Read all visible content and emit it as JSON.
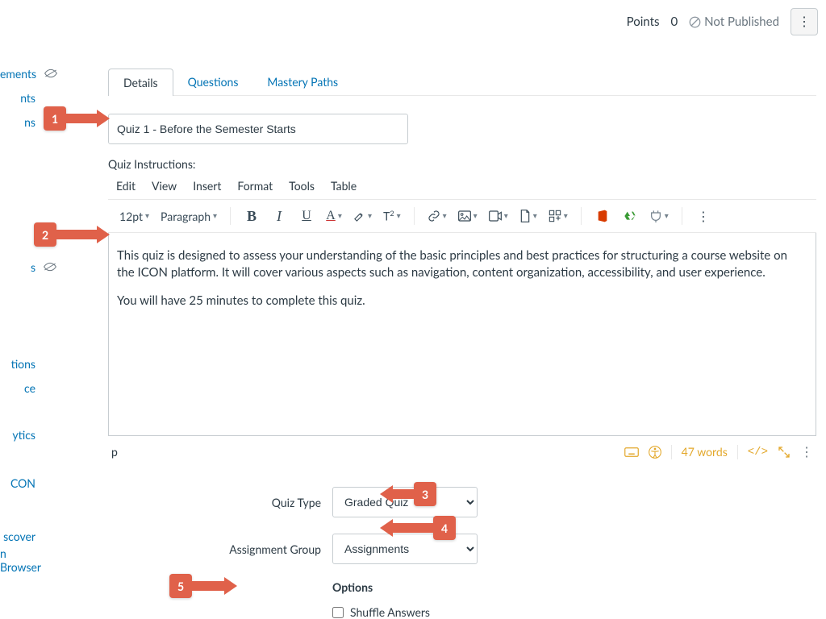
{
  "sidebar": {
    "items": [
      {
        "label": "ements",
        "hidden": true
      },
      {
        "label": "nts",
        "hidden": false
      },
      {
        "label": "ns",
        "hidden": false
      }
    ],
    "items2": [
      {
        "label": "s",
        "hidden": true
      }
    ],
    "items3": [
      {
        "label": "tions"
      },
      {
        "label": "ce"
      }
    ],
    "items4": [
      {
        "label": "ytics"
      }
    ],
    "items5": [
      {
        "label": "CON"
      }
    ],
    "items6": [
      {
        "label": "scover"
      },
      {
        "label": "n Browser"
      }
    ]
  },
  "header": {
    "points_label": "Points",
    "points_value": "0",
    "not_published": "Not Published"
  },
  "tabs": {
    "details": "Details",
    "questions": "Questions",
    "mastery": "Mastery Paths"
  },
  "title_value": "Quiz 1 - Before the Semester Starts",
  "instructions_label": "Quiz Instructions:",
  "rce_menu": {
    "edit": "Edit",
    "view": "View",
    "insert": "Insert",
    "format": "Format",
    "tools": "Tools",
    "table": "Table"
  },
  "toolbar": {
    "font_size": "12pt",
    "paragraph": "Paragraph"
  },
  "editor": {
    "p1": "This quiz is designed to assess your understanding of the basic principles and best practices for structuring a course website on the ICON platform. It will cover various aspects such as navigation, content organization, accessibility, and user experience.",
    "p2": "You will have 25 minutes to complete this quiz."
  },
  "footer": {
    "path": "p",
    "word_count": "47 words"
  },
  "settings": {
    "quiz_type_label": "Quiz Type",
    "quiz_type_value": "Graded Quiz",
    "assignment_group_label": "Assignment Group",
    "assignment_group_value": "Assignments",
    "options_label": "Options",
    "shuffle_label": "Shuffle Answers"
  },
  "callouts": {
    "c1": "1",
    "c2": "2",
    "c3": "3",
    "c4": "4",
    "c5": "5"
  }
}
